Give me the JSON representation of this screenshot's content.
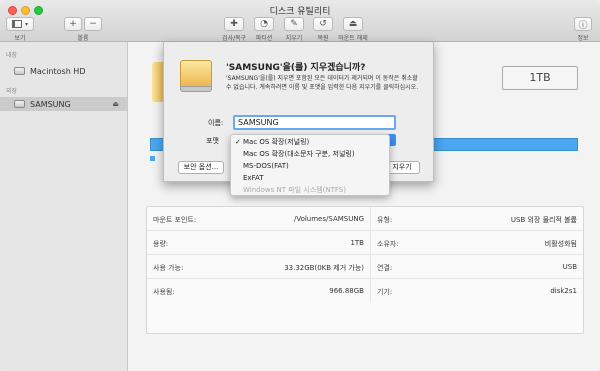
{
  "window": {
    "title": "디스크 유틸리티"
  },
  "toolbar": {
    "view_label": "보기",
    "volume_label": "볼륨",
    "add_symbol": "+",
    "remove_symbol": "−",
    "items": [
      {
        "label": "검사/복구",
        "icon": "first-aid-icon"
      },
      {
        "label": "파티션",
        "icon": "partition-icon"
      },
      {
        "label": "지우기",
        "icon": "erase-icon"
      },
      {
        "label": "복원",
        "icon": "restore-icon"
      },
      {
        "label": "마운트 해제",
        "icon": "unmount-icon"
      }
    ],
    "info_label": "정보"
  },
  "sidebar": {
    "internal_header": "내장",
    "external_header": "외장",
    "items": [
      {
        "label": "Macintosh HD",
        "icon": "internal-disk-icon"
      },
      {
        "label": "SAMSUNG",
        "icon": "external-disk-icon"
      }
    ]
  },
  "main": {
    "capacity": "1TB",
    "info": {
      "left": [
        {
          "label": "마운트 포인트:",
          "value": "/Volumes/SAMSUNG"
        },
        {
          "label": "용량:",
          "value": "1TB"
        },
        {
          "label": "사용 가능:",
          "value": "33.32GB(0KB 제거 가능)"
        },
        {
          "label": "사용됨:",
          "value": "966.88GB"
        }
      ],
      "right": [
        {
          "label": "유형:",
          "value": "USB 외장 물리적 볼륨"
        },
        {
          "label": "소유자:",
          "value": "비활성화됨"
        },
        {
          "label": "연결:",
          "value": "USB"
        },
        {
          "label": "기기:",
          "value": "disk2s1"
        }
      ]
    }
  },
  "sheet": {
    "title": "'SAMSUNG'을(를) 지우겠습니까?",
    "description": "'SAMSUNG'을(를) 지우면 포함된 모든 데이터가 제거되며 이 동작은 취소할 수 없습니다. 계속하려면 이름 및 포맷을 입력한 다음 지우기를 클릭하십시오.",
    "name_label": "이름:",
    "name_value": "SAMSUNG",
    "format_label": "포맷",
    "security_button": "보안 옵션...",
    "erase_button": "지우기"
  },
  "format_menu": {
    "items": [
      {
        "label": "Mac OS 확장(저널링)",
        "checked": "✓",
        "disabled": false
      },
      {
        "label": "Mac OS 확장(대소문자 구분, 저널링)",
        "checked": "",
        "disabled": false
      },
      {
        "label": "MS-DOS(FAT)",
        "checked": "",
        "disabled": false
      },
      {
        "label": "ExFAT",
        "checked": "",
        "disabled": false
      },
      {
        "label": "Windows NT 파일 시스템(NTFS)",
        "checked": "",
        "disabled": true
      }
    ]
  },
  "colors": {
    "accent": "#3d8ef6",
    "usage_bar": "#4aa7f0",
    "disk_yellow": "#ebb245"
  }
}
